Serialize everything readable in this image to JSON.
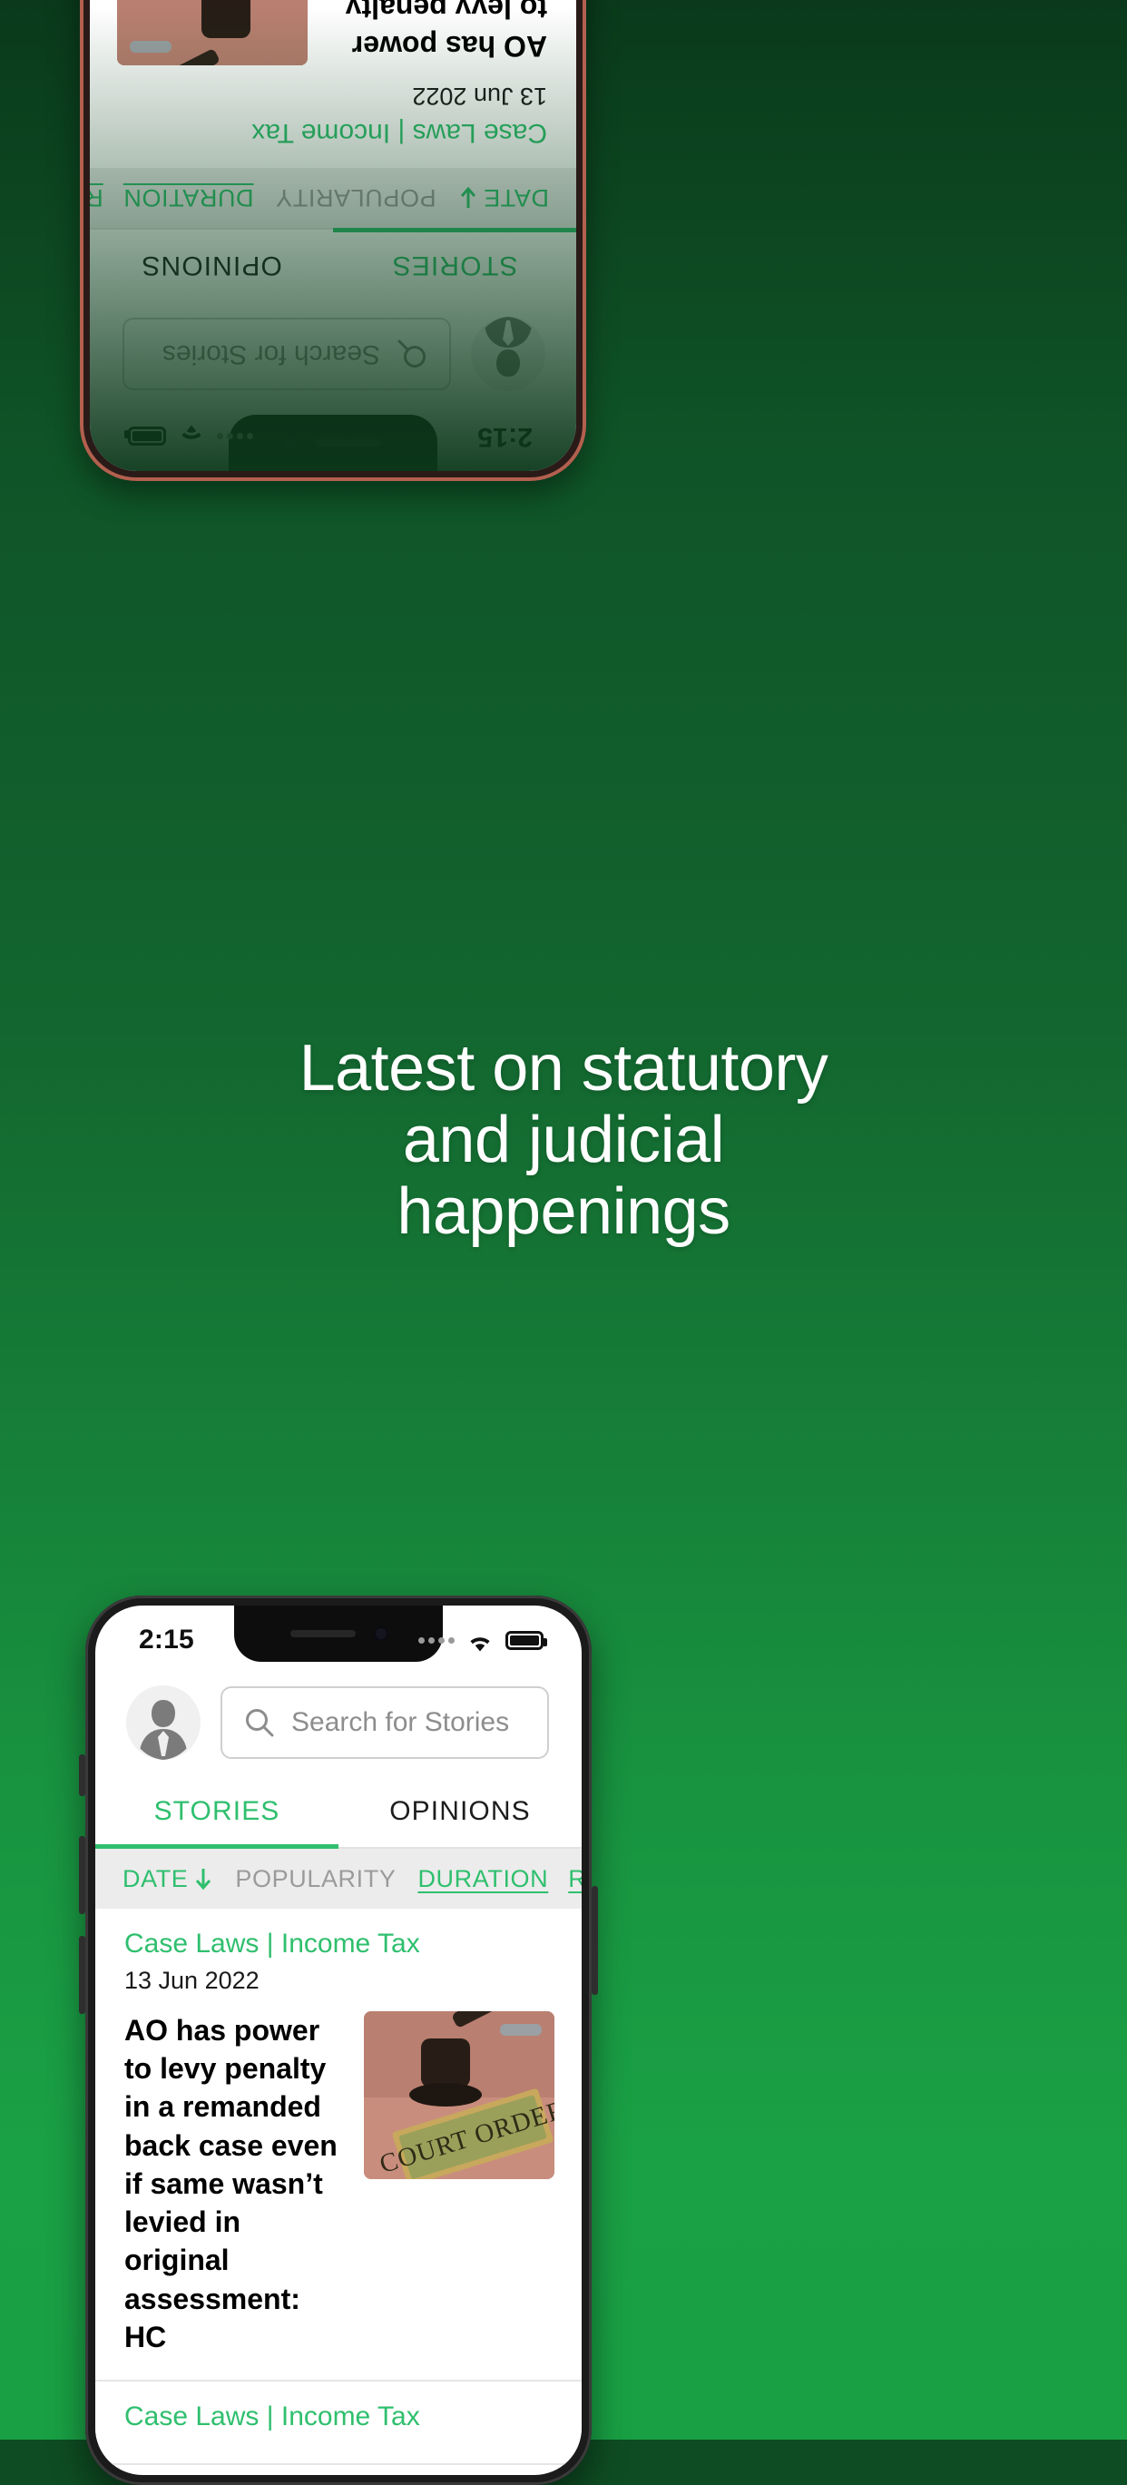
{
  "promo": {
    "headline_lines": [
      "Latest on statutory",
      "and judicial",
      "happenings"
    ],
    "background_color": "#13662f",
    "accent_color": "#2fbf6e"
  },
  "phone": {
    "status_bar": {
      "time": "2:15",
      "signal_icon": "signal-dots-icon",
      "wifi_icon": "wifi-icon",
      "battery_icon": "battery-icon"
    },
    "header": {
      "avatar_icon": "user-avatar-icon",
      "search": {
        "icon": "search-icon",
        "placeholder": "Search for Stories",
        "value": ""
      }
    },
    "tabs": [
      {
        "label": "STORIES",
        "active": true
      },
      {
        "label": "OPINIONS",
        "active": false
      }
    ],
    "sort_bar": {
      "date_label": "DATE",
      "date_arrow": "arrow-down-icon",
      "popularity_label": "POPULARITY",
      "duration_label": "DURATION",
      "reset_label": "RESET",
      "filter_icon": "sliders-filter-icon"
    },
    "articles": [
      {
        "category": "Case Laws | Income Tax",
        "date": "13 Jun 2022",
        "title": "AO has power to levy penalty in a remanded back case even if same wasn’t levied in original assessment: HC",
        "thumbnail_text": "COURT ORDER",
        "thumbnail_icon": "gavel-court-order-image"
      },
      {
        "category": "Case Laws | Income Tax",
        "date": "",
        "title": "",
        "thumbnail_text": "",
        "thumbnail_icon": ""
      }
    ]
  }
}
